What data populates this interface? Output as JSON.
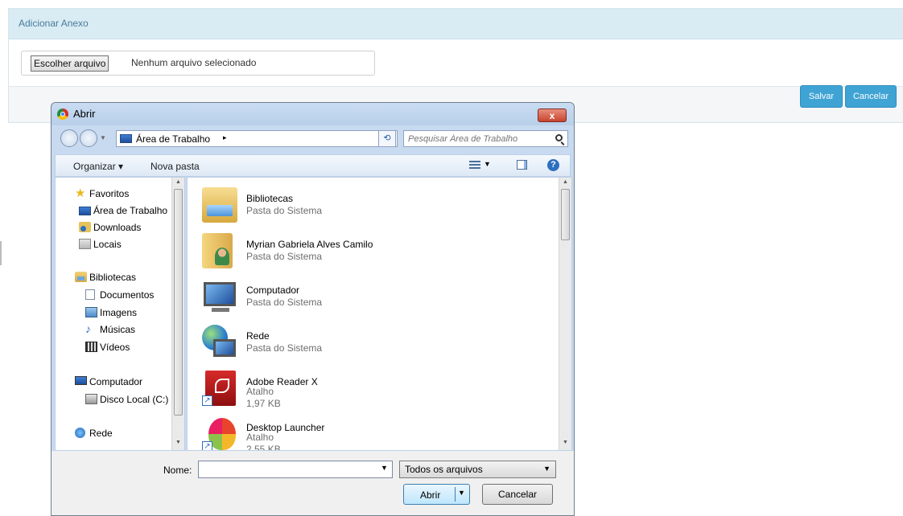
{
  "panel": {
    "title": "Adicionar Anexo",
    "file_button": "Escolher arquivo",
    "file_status": "Nenhum arquivo selecionado",
    "save_label": "Salvar",
    "cancel_label": "Cancelar",
    "button_color": "#3fa3d4"
  },
  "dialog": {
    "title": "Abrir",
    "close_label": "x",
    "address": "Área de Trabalho",
    "address_arrow": "▸",
    "search_placeholder": "Pesquisar Área de Trabalho",
    "toolbar": {
      "organize": "Organizar ▾",
      "new_folder": "Nova pasta"
    },
    "nav": {
      "favorites": "Favoritos",
      "desktop": "Área de Trabalho",
      "downloads": "Downloads",
      "places": "Locais",
      "libraries": "Bibliotecas",
      "documents": "Documentos",
      "images": "Imagens",
      "music": "Músicas",
      "videos": "Vídeos",
      "computer": "Computador",
      "local_disk": "Disco Local (C:)",
      "network": "Rede"
    },
    "files": [
      {
        "name": "Bibliotecas",
        "type": "Pasta do Sistema",
        "icon": "libraries-folder-icon"
      },
      {
        "name": "Myrian Gabriela Alves Camilo",
        "type": "Pasta do Sistema",
        "icon": "user-folder-icon"
      },
      {
        "name": "Computador",
        "type": "Pasta do Sistema",
        "icon": "computer-icon"
      },
      {
        "name": "Rede",
        "type": "Pasta do Sistema",
        "icon": "network-icon"
      },
      {
        "name": "Adobe Reader X",
        "type": "Atalho",
        "size": "1,97 KB",
        "icon": "adobe-reader-icon"
      },
      {
        "name": "Desktop Launcher",
        "type": "Atalho",
        "size": "2,55 KB",
        "icon": "desktop-launcher-icon"
      }
    ],
    "filename_label": "Nome:",
    "filename_value": "",
    "filetype": "Todos os arquivos",
    "open_label": "Abrir",
    "cancel_label": "Cancelar"
  }
}
